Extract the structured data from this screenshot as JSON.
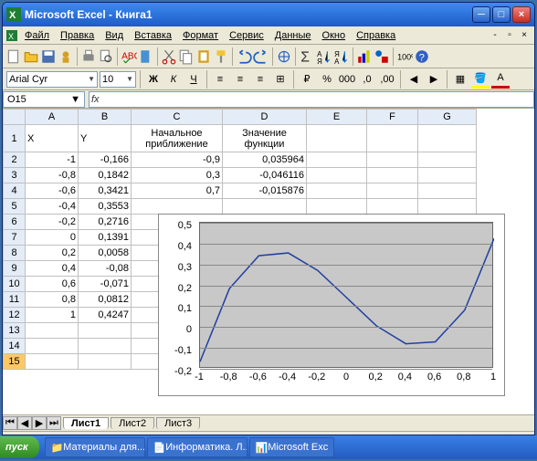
{
  "title": "Microsoft Excel - Книга1",
  "menu": [
    "Файл",
    "Правка",
    "Вид",
    "Вставка",
    "Формат",
    "Сервис",
    "Данные",
    "Окно",
    "Справка"
  ],
  "font": {
    "name": "Arial Cyr",
    "size": "10"
  },
  "cellref": "O15",
  "cols": [
    "A",
    "B",
    "C",
    "D",
    "E",
    "F",
    "G"
  ],
  "headers": {
    "c1": "Начальное приближение",
    "d1": "Значение функции",
    "a1": "X",
    "b1": "Y"
  },
  "data": {
    "x": [
      "-1",
      "-0,8",
      "-0,6",
      "-0,4",
      "-0,2",
      "0",
      "0,2",
      "0,4",
      "0,6",
      "0,8",
      "1"
    ],
    "y": [
      "-0,166",
      "0,1842",
      "0,3421",
      "0,3553",
      "0,2716",
      "0,1391",
      "0,0058",
      "-0,08",
      "-0,071",
      "0,0812",
      "0,4247"
    ],
    "c": [
      "-0,9",
      "0,3",
      "0,7"
    ],
    "d": [
      "0,035964",
      "-0,046116",
      "-0,015876"
    ]
  },
  "tabs": [
    "Лист1",
    "Лист2",
    "Лист3"
  ],
  "taskbar": {
    "start": "пуск",
    "t1": "Материалы для...",
    "t2": "Информатика. Л...",
    "t3": "Microsoft Exc"
  },
  "chart_data": {
    "type": "line",
    "title": "",
    "xlabel": "",
    "ylabel": "",
    "xlim": [
      -1,
      1
    ],
    "ylim": [
      -0.2,
      0.5
    ],
    "xticks": [
      -1,
      -0.8,
      -0.6,
      -0.4,
      -0.2,
      0,
      0.2,
      0.4,
      0.6,
      0.8,
      1
    ],
    "yticks": [
      -0.2,
      -0.1,
      0,
      0.1,
      0.2,
      0.3,
      0.4,
      0.5
    ],
    "x": [
      -1,
      -0.8,
      -0.6,
      -0.4,
      -0.2,
      0,
      0.2,
      0.4,
      0.6,
      0.8,
      1
    ],
    "y": [
      -0.166,
      0.1842,
      0.3421,
      0.3553,
      0.2716,
      0.1391,
      0.0058,
      -0.08,
      -0.071,
      0.0812,
      0.4247
    ]
  }
}
